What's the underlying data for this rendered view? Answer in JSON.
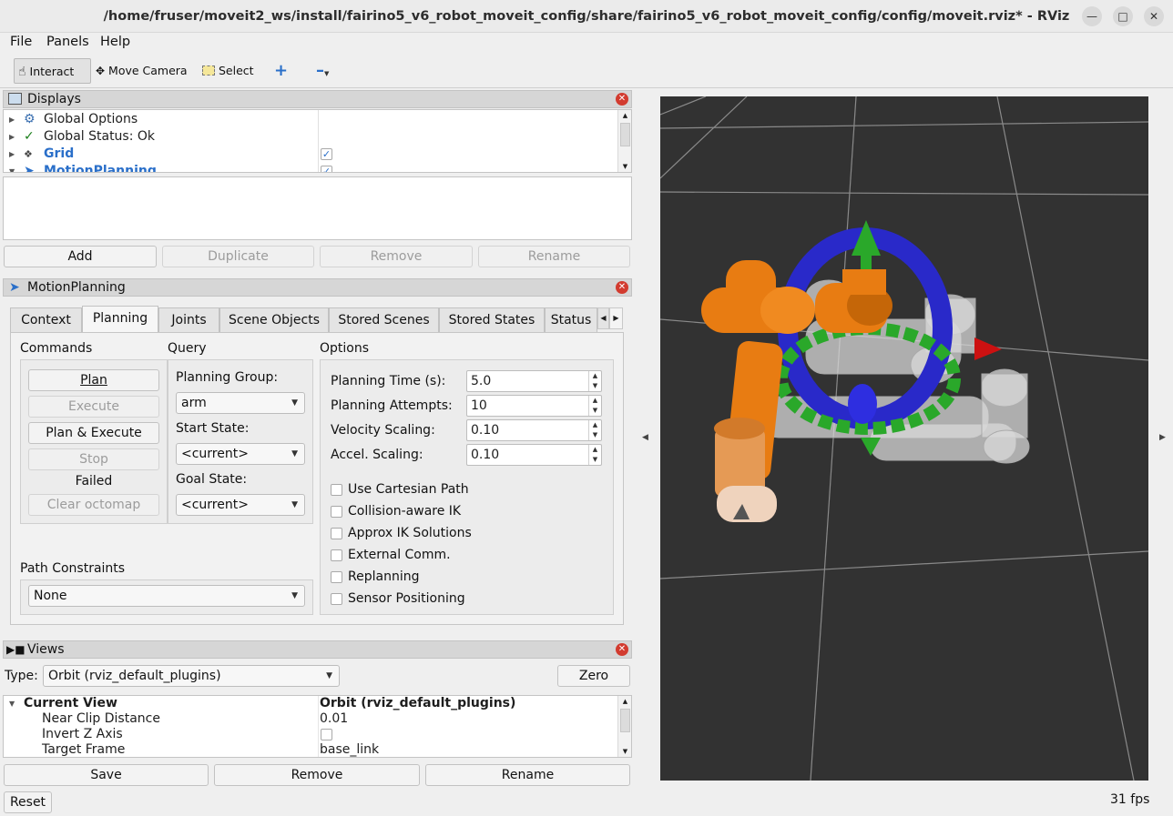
{
  "window": {
    "title": "/home/fruser/moveit2_ws/install/fairino5_v6_robot_moveit_config/share/fairino5_v6_robot_moveit_config/config/moveit.rviz* - RViz",
    "minimize_icon": "minimize-icon",
    "maximize_icon": "maximize-icon",
    "close_icon": "close-icon"
  },
  "menubar": {
    "file": "File",
    "panels": "Panels",
    "help": "Help"
  },
  "toolbar": {
    "interact": "Interact",
    "move_camera": "Move Camera",
    "select": "Select",
    "add_tool_icon": "plus-icon",
    "remove_tool_icon": "minus-icon"
  },
  "displays": {
    "title": "Displays",
    "items": [
      {
        "label": "Global Options",
        "icon": "gear-icon",
        "checked": false
      },
      {
        "label": "Global Status: Ok",
        "icon": "checkmark-icon",
        "checked": false
      },
      {
        "label": "Grid",
        "icon": "grid-icon",
        "checked": true
      },
      {
        "label": "MotionPlanning",
        "icon": "motion-planning-icon",
        "checked": true
      }
    ],
    "buttons": {
      "add": "Add",
      "duplicate": "Duplicate",
      "remove": "Remove",
      "rename": "Rename"
    }
  },
  "motion_planning": {
    "title": "MotionPlanning",
    "tabs": [
      "Context",
      "Planning",
      "Joints",
      "Scene Objects",
      "Stored Scenes",
      "Stored States",
      "Status"
    ],
    "active_tab": "Planning",
    "commands": {
      "heading": "Commands",
      "plan": "Plan",
      "execute": "Execute",
      "plan_execute": "Plan & Execute",
      "stop": "Stop",
      "status": "Failed",
      "clear_octomap": "Clear octomap"
    },
    "query": {
      "heading": "Query",
      "planning_group_label": "Planning Group:",
      "planning_group": "arm",
      "start_state_label": "Start State:",
      "start_state": "<current>",
      "goal_state_label": "Goal State:",
      "goal_state": "<current>"
    },
    "options": {
      "heading": "Options",
      "planning_time_label": "Planning Time (s):",
      "planning_time": "5.0",
      "planning_attempts_label": "Planning Attempts:",
      "planning_attempts": "10",
      "velocity_scaling_label": "Velocity Scaling:",
      "velocity_scaling": "0.10",
      "accel_scaling_label": "Accel. Scaling:",
      "accel_scaling": "0.10",
      "checkboxes": [
        {
          "label": "Use Cartesian Path",
          "checked": false
        },
        {
          "label": "Collision-aware IK",
          "checked": false
        },
        {
          "label": "Approx IK Solutions",
          "checked": false
        },
        {
          "label": "External Comm.",
          "checked": false
        },
        {
          "label": "Replanning",
          "checked": false
        },
        {
          "label": "Sensor Positioning",
          "checked": false
        }
      ]
    },
    "path_constraints": {
      "label": "Path Constraints",
      "value": "None"
    }
  },
  "views": {
    "title": "Views",
    "type_label": "Type:",
    "type_value": "Orbit (rviz_default_plugins)",
    "zero": "Zero",
    "rows": [
      {
        "name": "Current View",
        "value": "Orbit (rviz_default_plugins)"
      },
      {
        "name": "Near Clip Distance",
        "value": "0.01"
      },
      {
        "name": "Invert Z Axis",
        "value": ""
      },
      {
        "name": "Target Frame",
        "value": "base_link"
      }
    ],
    "buttons": {
      "save": "Save",
      "remove": "Remove",
      "rename": "Rename"
    }
  },
  "statusbar": {
    "reset": "Reset",
    "fps": "31 fps"
  },
  "colors": {
    "accent": "#2a6fc9",
    "robot_orange": "#e87c12",
    "viewport_bg": "#323232",
    "close_red": "#d23b2f"
  }
}
